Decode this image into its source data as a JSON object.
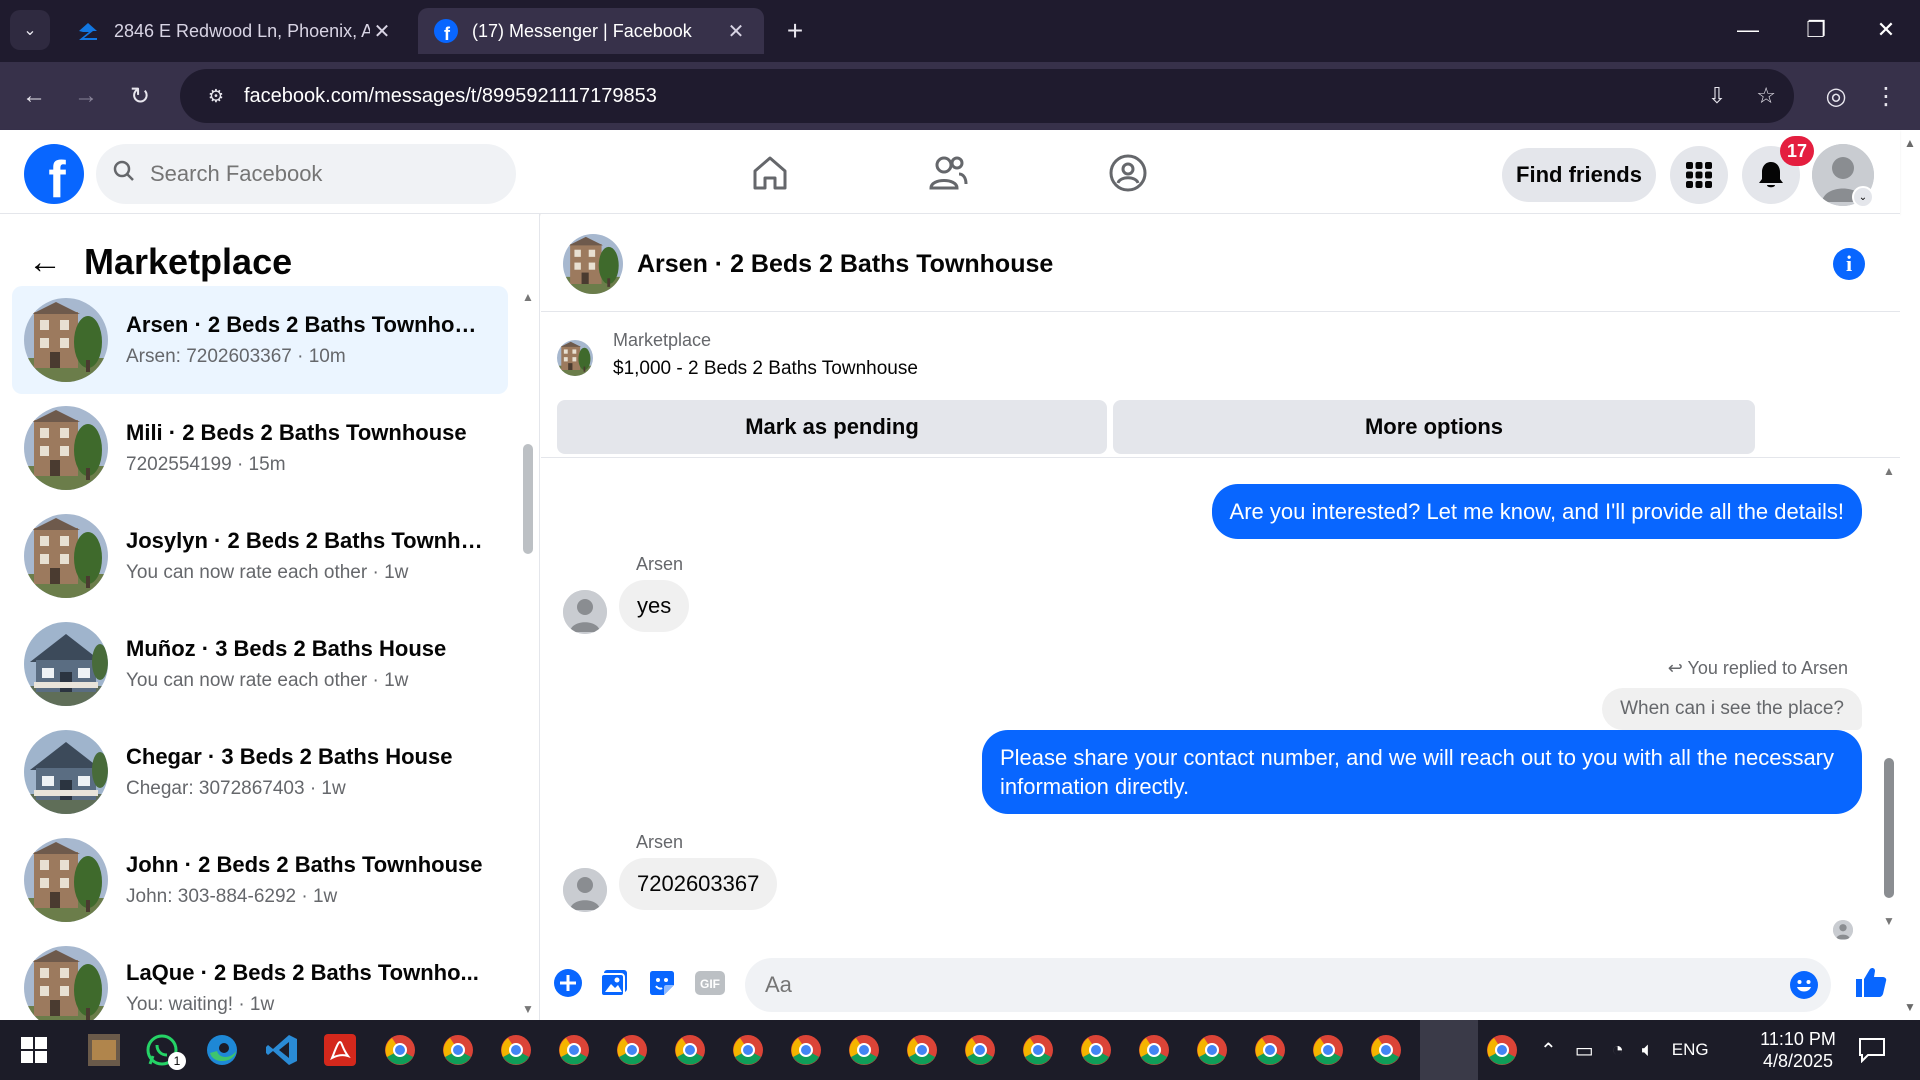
{
  "browser": {
    "tabs": [
      {
        "title": "2846 E Redwood Ln, Phoenix, A",
        "favicon": "zillow-icon"
      },
      {
        "title": "(17) Messenger | Facebook",
        "favicon": "facebook-icon"
      }
    ],
    "url": "facebook.com/messages/t/8995921117179853"
  },
  "fb": {
    "search_placeholder": "Search Facebook",
    "find_friends": "Find friends",
    "notif_count": "17"
  },
  "left": {
    "title": "Marketplace",
    "conversations": [
      {
        "name": "Arsen · 2 Beds 2 Baths Townhouse",
        "sub": "Arsen: 7202603367 · 10m",
        "thumb": "townhouse"
      },
      {
        "name": "Mili · 2 Beds 2 Baths Townhouse",
        "sub": "7202554199 · 15m",
        "thumb": "townhouse"
      },
      {
        "name": "Josylyn · 2 Beds 2 Baths Townho...",
        "sub": "You can now rate each other · 1w",
        "thumb": "townhouse"
      },
      {
        "name": "Muñoz · 3 Beds 2 Baths House",
        "sub": "You can now rate each other · 1w",
        "thumb": "house"
      },
      {
        "name": "Chegar · 3 Beds 2 Baths House",
        "sub": "Chegar: 3072867403 · 1w",
        "thumb": "house"
      },
      {
        "name": "John · 2 Beds 2 Baths Townhouse",
        "sub": "John: 303-884-6292 · 1w",
        "thumb": "townhouse"
      },
      {
        "name": "LaQue · 2 Beds 2 Baths Townho...",
        "sub": "You: waiting! · 1w",
        "thumb": "townhouse"
      }
    ]
  },
  "chat": {
    "title": "Arsen · 2 Beds 2 Baths Townhouse",
    "marketplace_label": "Marketplace",
    "listing": "$1,000 - 2 Beds 2 Baths Townhouse",
    "mark_pending": "Mark as pending",
    "more_options": "More options",
    "messages": {
      "out1": "Are you interested? Let me know, and I'll provide all the details!",
      "sender1": "Arsen",
      "in1": "yes",
      "reply_note": "You replied to Arsen",
      "reply_quote": "When can i see the place?",
      "out2": "Please share your contact number, and we will reach out to you with all the necessary information directly.",
      "sender2": "Arsen",
      "in2": "7202603367"
    },
    "composer_placeholder": "Aa"
  },
  "taskbar": {
    "lang": "ENG",
    "time": "11:10 PM",
    "date": "4/8/2025",
    "whatsapp_badge": "1"
  },
  "colors": {
    "fb_blue": "#0866ff",
    "active_conv": "#ebf5ff",
    "notif_red": "#e41e3f"
  }
}
